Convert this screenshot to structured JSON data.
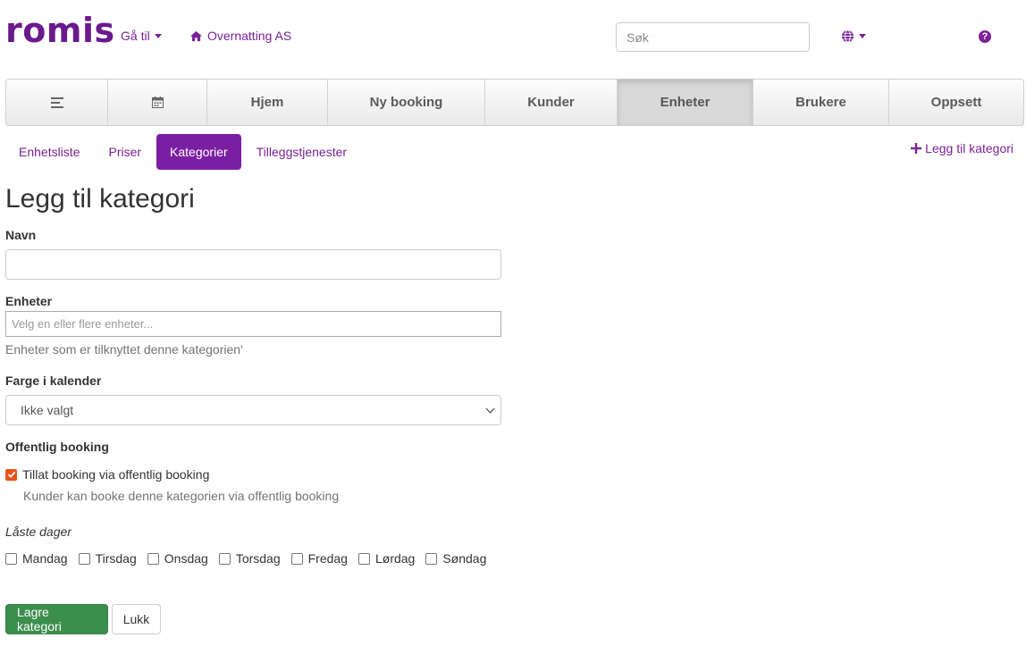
{
  "header": {
    "logo": "romis",
    "goto_label": "Gå til",
    "company": "Overnatting AS",
    "search_placeholder": "Søk",
    "icons": {
      "home": "home-icon",
      "globe": "globe-icon",
      "help": "question-circle-icon"
    }
  },
  "main_nav": {
    "items": [
      {
        "label": "",
        "icon": "menu-icon"
      },
      {
        "label": "",
        "icon": "calendar-icon"
      },
      {
        "label": "Hjem"
      },
      {
        "label": "Ny booking"
      },
      {
        "label": "Kunder"
      },
      {
        "label": "Enheter",
        "active": true
      },
      {
        "label": "Brukere"
      },
      {
        "label": "Oppsett"
      }
    ]
  },
  "sub_nav": {
    "tabs": [
      {
        "label": "Enhetsliste"
      },
      {
        "label": "Priser"
      },
      {
        "label": "Kategorier",
        "active": true
      },
      {
        "label": "Tilleggstjenester"
      }
    ],
    "add_label": "Legg til kategori"
  },
  "form": {
    "title": "Legg til kategori",
    "name_label": "Navn",
    "name_value": "",
    "units_label": "Enheter",
    "units_placeholder": "Velg en eller flere enheter...",
    "units_help": "Enheter som er tilknyttet denne kategorien'",
    "color_label": "Farge i kalender",
    "color_value": "Ikke valgt",
    "public_label": "Offentlig booking",
    "public_checkbox_label": "Tillat booking via offentlig booking",
    "public_checked": true,
    "public_help": "Kunder kan booke denne kategorien via offentlig booking",
    "locked_days_label": "Låste dager",
    "days": [
      {
        "label": "Mandag",
        "checked": false
      },
      {
        "label": "Tirsdag",
        "checked": false
      },
      {
        "label": "Onsdag",
        "checked": false
      },
      {
        "label": "Torsdag",
        "checked": false
      },
      {
        "label": "Fredag",
        "checked": false
      },
      {
        "label": "Lørdag",
        "checked": false
      },
      {
        "label": "Søndag",
        "checked": false
      }
    ],
    "save_label": "Lagre kategori",
    "close_label": "Lukk"
  },
  "colors": {
    "brand_purple": "#7b2196",
    "active_pill": "#7b1fa2",
    "save_green": "#3c8e4c",
    "checkbox_orange": "#e8541a"
  }
}
